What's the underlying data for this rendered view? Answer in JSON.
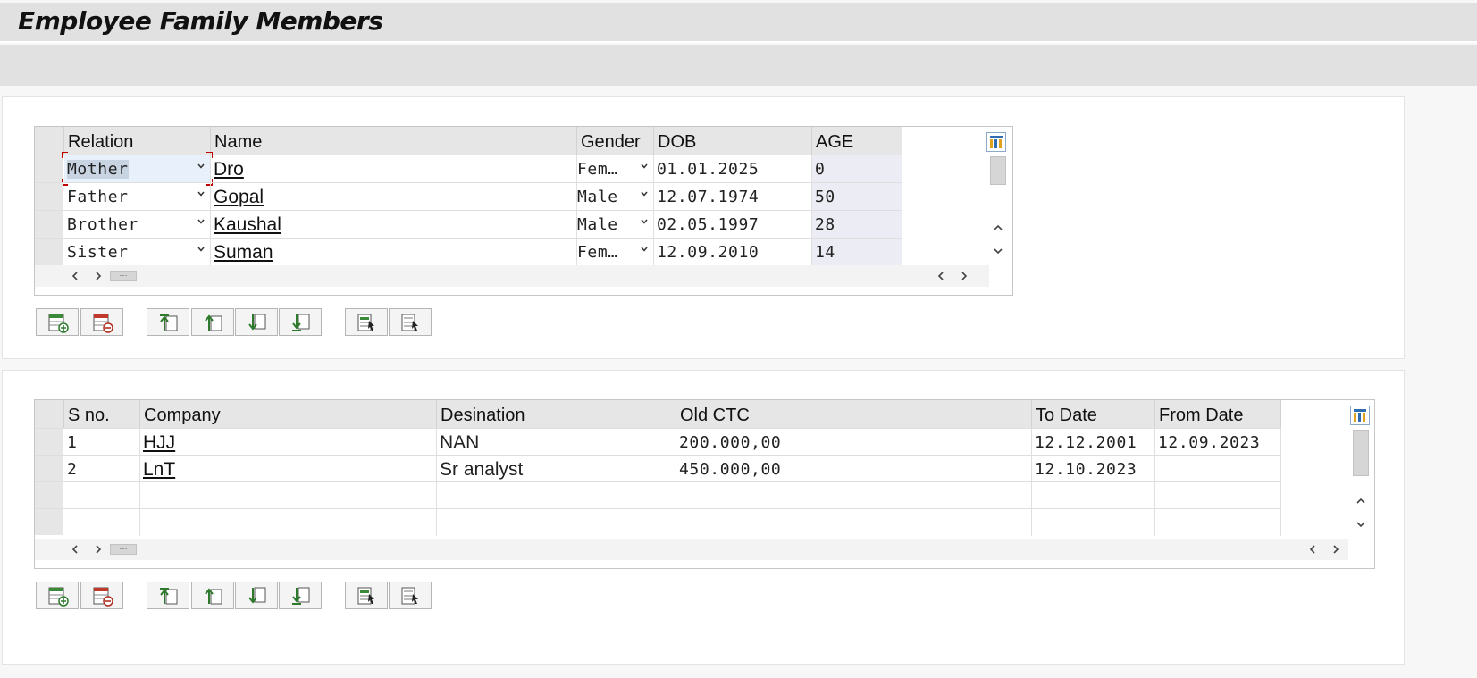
{
  "page": {
    "title": "Employee Family Members"
  },
  "family_table": {
    "columns": [
      "Relation",
      "Name",
      "Gender",
      "DOB",
      "AGE"
    ],
    "rows": [
      {
        "relation": "Mother",
        "name": "Dro",
        "gender": "Fem…",
        "dob": "01.01.2025",
        "age": "0"
      },
      {
        "relation": "Father",
        "name": "Gopal",
        "gender": "Male",
        "dob": "12.07.1974",
        "age": "50"
      },
      {
        "relation": "Brother",
        "name": "Kaushal",
        "gender": "Male",
        "dob": "02.05.1997",
        "age": "28"
      },
      {
        "relation": "Sister",
        "name": "Suman",
        "gender": "Fem…",
        "dob": "12.09.2010",
        "age": "14"
      }
    ]
  },
  "employment_table": {
    "columns": [
      "S no.",
      "Company",
      "Desination",
      "Old CTC",
      "To Date",
      "From Date"
    ],
    "rows": [
      {
        "sno": "1",
        "company": "HJJ",
        "designation": "NAN",
        "old_ctc": "200.000,00",
        "to_date": "12.12.2001",
        "from_date": "12.09.2023"
      },
      {
        "sno": "2",
        "company": "LnT",
        "designation": "Sr analyst",
        "old_ctc": "450.000,00",
        "to_date": "12.10.2023",
        "from_date": ""
      },
      {
        "sno": "",
        "company": "",
        "designation": "",
        "old_ctc": "",
        "to_date": "",
        "from_date": ""
      },
      {
        "sno": "",
        "company": "",
        "designation": "",
        "old_ctc": "",
        "to_date": "",
        "from_date": ""
      }
    ]
  },
  "toolbar_buttons": [
    "insert-row",
    "delete-row",
    "move-to-top",
    "move-up",
    "move-down",
    "move-to-bottom",
    "select-block",
    "deselect-block"
  ],
  "colors": {
    "header_bg": "#e6e6e6",
    "readonly_bg": "#ececf4",
    "focus_red": "#c00000"
  }
}
